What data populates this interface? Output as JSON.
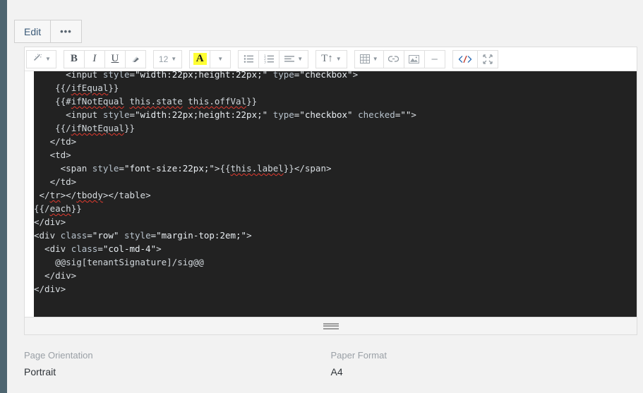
{
  "window": {
    "background": "#f2f2f2",
    "rail_color": "#4e6570"
  },
  "tabs": [
    {
      "label": "Edit",
      "name": "tab-edit"
    },
    {
      "label": "•••",
      "name": "tab-more"
    }
  ],
  "toolbar": {
    "groups": [
      {
        "name": "style-group",
        "buttons": [
          {
            "name": "magic-wand-icon",
            "icon": "magic-wand",
            "caret": true,
            "label": ""
          }
        ]
      },
      {
        "name": "text-format-group",
        "buttons": [
          {
            "name": "bold-button",
            "icon": "bold",
            "label": "B"
          },
          {
            "name": "italic-button",
            "icon": "italic",
            "label": "I"
          },
          {
            "name": "underline-button",
            "icon": "underline",
            "label": "U"
          },
          {
            "name": "eraser-button",
            "icon": "eraser",
            "label": ""
          }
        ]
      },
      {
        "name": "font-size-group",
        "buttons": [
          {
            "name": "font-size-select",
            "icon": "text",
            "label": "12",
            "caret": true
          }
        ]
      },
      {
        "name": "text-color-group",
        "buttons": [
          {
            "name": "text-color-button",
            "icon": "highlight-a",
            "label": "A"
          },
          {
            "name": "text-color-dropdown",
            "icon": "caret-down",
            "label": ""
          }
        ]
      },
      {
        "name": "list-group",
        "buttons": [
          {
            "name": "unordered-list-button",
            "icon": "ul",
            "label": ""
          },
          {
            "name": "ordered-list-button",
            "icon": "ol",
            "label": ""
          },
          {
            "name": "align-button",
            "icon": "align",
            "label": "",
            "caret": true
          }
        ]
      },
      {
        "name": "paragraph-group",
        "buttons": [
          {
            "name": "paragraph-format-button",
            "icon": "TI",
            "label": "T↑",
            "caret": true
          }
        ]
      },
      {
        "name": "insert-group",
        "buttons": [
          {
            "name": "table-button",
            "icon": "table",
            "label": "",
            "caret": true
          },
          {
            "name": "link-button",
            "icon": "link",
            "label": ""
          },
          {
            "name": "image-button",
            "icon": "image",
            "label": ""
          },
          {
            "name": "horizontal-rule-button",
            "icon": "hr",
            "label": "–"
          }
        ]
      },
      {
        "name": "view-group",
        "buttons": [
          {
            "name": "code-view-button",
            "icon": "code",
            "label": "</>"
          },
          {
            "name": "fullscreen-button",
            "icon": "fullscreen",
            "label": ""
          }
        ]
      }
    ]
  },
  "code_editor": {
    "font_size": "12.5px",
    "background": "#222222",
    "lines": [
      "      <input style=\"width:22px;height:22px;\" type=\"checkbox\">",
      "    {{/ifEqual}}",
      "    {{#ifNotEqual this.state this.offVal}}",
      "      <input style=\"width:22px;height:22px;\" type=\"checkbox\" checked=\"\">",
      "    {{/ifNotEqual}}",
      "   </td>",
      "   <td>",
      "     <span style=\"font-size:22px;\">{{this.label}}</span>",
      "   </td>",
      " </tr></tbody></table>",
      "{{/each}}",
      "</div>",
      "<div class=\"row\" style=\"margin-top:2em;\">",
      "  <div class=\"col-md-4\">",
      "    @@sig[tenantSignature]/sig@@",
      "  </div>",
      "</div>"
    ],
    "misspelled_words": [
      "ifEqual",
      "ifNotEqual",
      "this.state",
      "this.offVal",
      "this.label",
      "tr",
      "tbody",
      "each"
    ]
  },
  "resize_handle": {
    "name": "editor-resize-grip"
  },
  "fields": [
    {
      "label": "Page Orientation",
      "value": "Portrait",
      "name": "page-orientation"
    },
    {
      "label": "Paper Format",
      "value": "A4",
      "name": "paper-format"
    }
  ]
}
